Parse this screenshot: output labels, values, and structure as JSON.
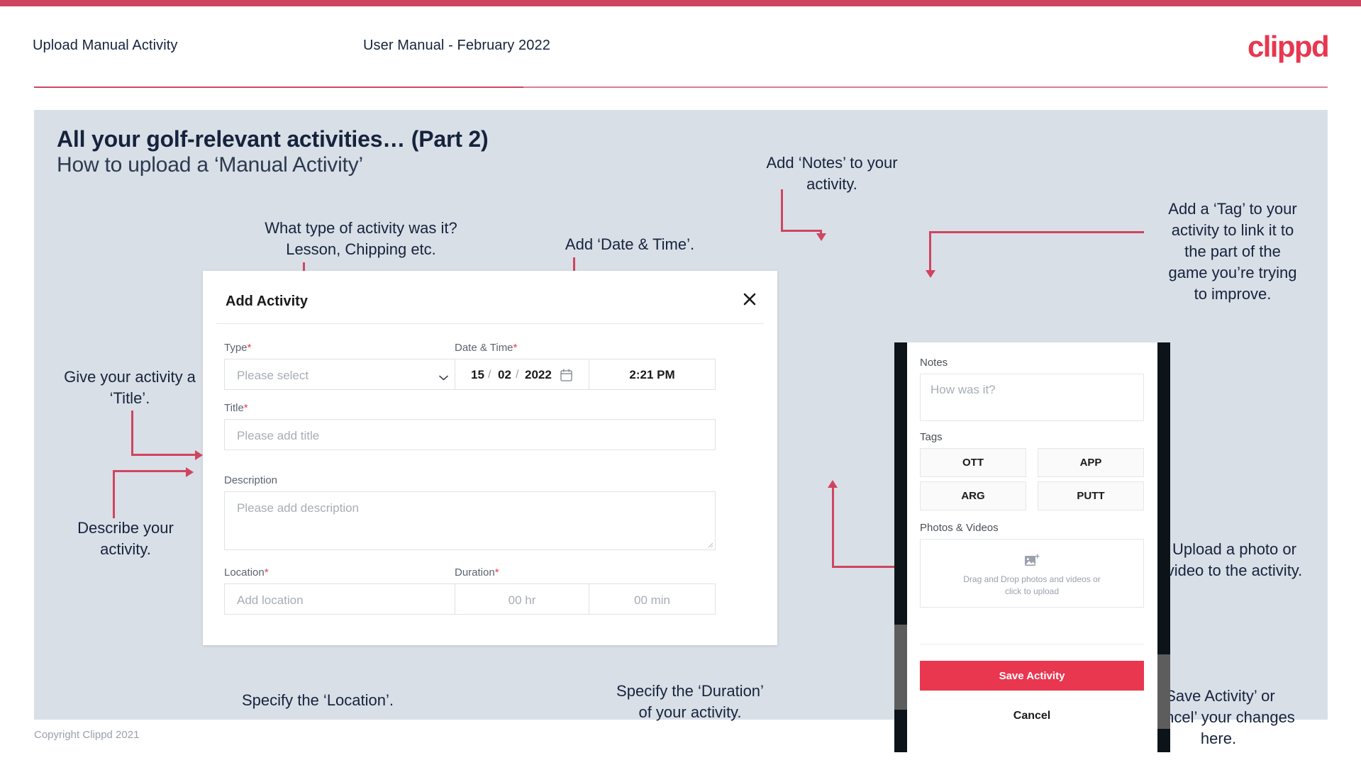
{
  "header": {
    "title": "Upload Manual Activity",
    "subtitle": "User Manual - February 2022",
    "logo": "clippd"
  },
  "slide": {
    "heading": "All your golf-relevant activities… (Part 2)",
    "subheading": "How to upload a ‘Manual Activity’"
  },
  "dialog": {
    "title": "Add Activity",
    "close_icon": "close-icon",
    "fields": {
      "type": {
        "label": "Type",
        "required": "*",
        "placeholder": "Please select",
        "chevron_icon": "chevron-down-icon"
      },
      "datetime": {
        "label": "Date & Time",
        "required": "*",
        "day": "15",
        "month": "02",
        "year": "2022",
        "sep1": "/",
        "sep2": "/",
        "calendar_icon": "calendar-icon",
        "time": "2:21 PM"
      },
      "title": {
        "label": "Title",
        "required": "*",
        "placeholder": "Please add title"
      },
      "description": {
        "label": "Description",
        "placeholder": "Please add description"
      },
      "location": {
        "label": "Location",
        "required": "*",
        "placeholder": "Add location"
      },
      "duration": {
        "label": "Duration",
        "required": "*",
        "hours": "00 hr",
        "minutes": "00 min"
      }
    }
  },
  "phone": {
    "notes": {
      "label": "Notes",
      "placeholder": "How was it?"
    },
    "tags": {
      "label": "Tags",
      "items": [
        "OTT",
        "APP",
        "ARG",
        "PUTT"
      ]
    },
    "photos": {
      "label": "Photos & Videos",
      "icon": "add-image-icon",
      "line1": "Drag and Drop photos and videos or",
      "line2": "click to upload"
    },
    "save_label": "Save Activity",
    "cancel_label": "Cancel"
  },
  "annotations": {
    "type": "What type of activity was it?\nLesson, Chipping etc.",
    "datetime": "Add ‘Date & Time’.",
    "title": "Give your activity a\n‘Title’.",
    "description": "Describe your\nactivity.",
    "location": "Specify the ‘Location’.",
    "duration": "Specify the ‘Duration’\nof your activity.",
    "notes": "Add ‘Notes’ to your\nactivity.",
    "tags": "Add a ‘Tag’ to your\nactivity to link it to\nthe part of the\ngame you’re trying\nto improve.",
    "photos": "Upload a photo or\nvideo to the activity.",
    "save": "‘Save Activity’ or\n‘Cancel’ your changes\nhere."
  },
  "footer": {
    "copyright": "Copyright Clippd 2021"
  },
  "colors": {
    "brand": "#e8374f",
    "accent": "#cf4560",
    "slide_bg": "#d9dfe7",
    "text": "#16233c"
  }
}
